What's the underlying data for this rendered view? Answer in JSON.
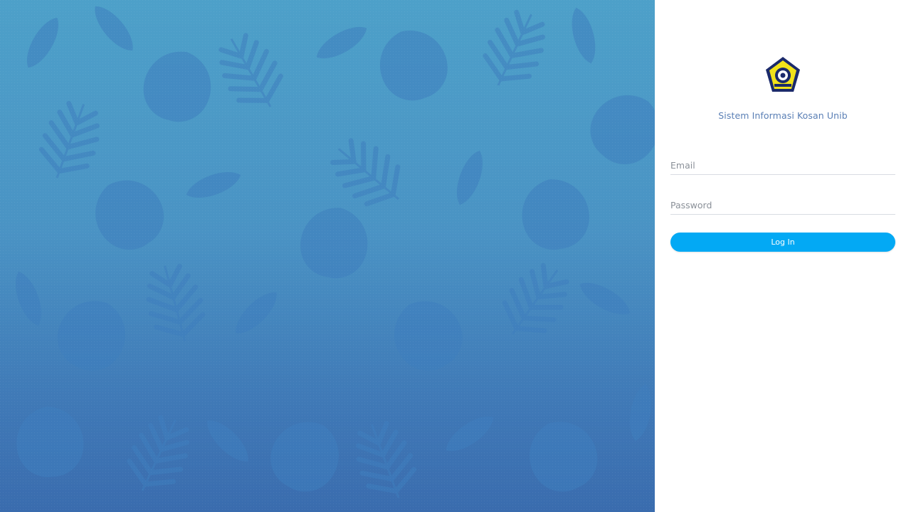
{
  "branding": {
    "logo_icon": "university-crest-icon",
    "title": "Sistem Informasi Kosan Unib"
  },
  "login_form": {
    "email_placeholder": "Email",
    "email_value": "",
    "password_placeholder": "Password",
    "password_value": "",
    "submit_label": "Log In"
  },
  "hero": {
    "pattern_icon": "tropical-leaf-pattern",
    "gradient_top": "#4da0c9",
    "gradient_bottom": "#3a6cae"
  },
  "colors": {
    "accent": "#03a9f4",
    "title_text": "#5a7fb5"
  }
}
